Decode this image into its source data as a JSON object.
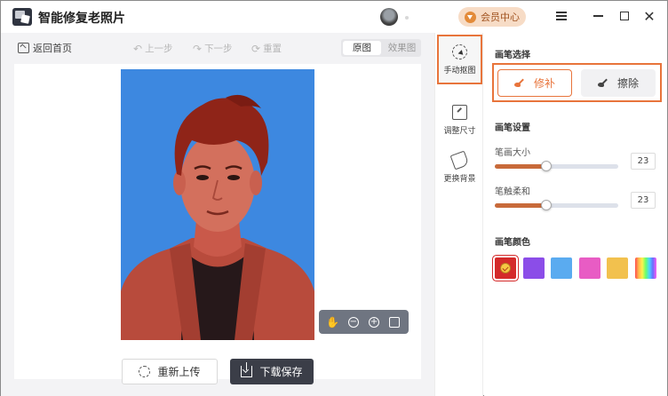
{
  "app": {
    "title": "智能修复老照片"
  },
  "header": {
    "vip_label": "会员中心"
  },
  "toolbar": {
    "back_label": "返回首页",
    "undo_label": "上一步",
    "redo_label": "下一步",
    "reset_label": "重置",
    "view_original": "原图",
    "view_result": "效果图",
    "view_selected": "原图"
  },
  "canvas": {
    "zoom_tools": [
      "hand-icon",
      "zoom-out-icon",
      "zoom-in-icon",
      "fit-icon"
    ]
  },
  "actions": {
    "reupload_label": "重新上传",
    "download_label": "下载保存"
  },
  "rail": {
    "items": [
      {
        "label": "手动抠图",
        "icon": "cutout-icon",
        "active": true
      },
      {
        "label": "调整尺寸",
        "icon": "resize-icon",
        "active": false
      },
      {
        "label": "更换背景",
        "icon": "bucket-icon",
        "active": false
      }
    ]
  },
  "panel": {
    "brush_select_title": "画笔选择",
    "brush_repair_label": "修补",
    "brush_erase_label": "擦除",
    "brush_settings_title": "画笔设置",
    "brush_size_label": "笔画大小",
    "brush_size_value": "23",
    "brush_size_fraction": 0.42,
    "brush_softness_label": "笔触柔和",
    "brush_softness_value": "23",
    "brush_softness_fraction": 0.42,
    "brush_color_title": "画笔颜色",
    "colors": [
      "#d42a2a",
      "#8b4de8",
      "#5aabf0",
      "#e85cc4",
      "#f2c14e",
      "rainbow"
    ],
    "selected_color_index": 0
  },
  "colors": {
    "accent": "#e8743b",
    "photo_background": "#3d88e0",
    "mask_red": "#c94a3a",
    "dark_button": "#3b3e48"
  }
}
